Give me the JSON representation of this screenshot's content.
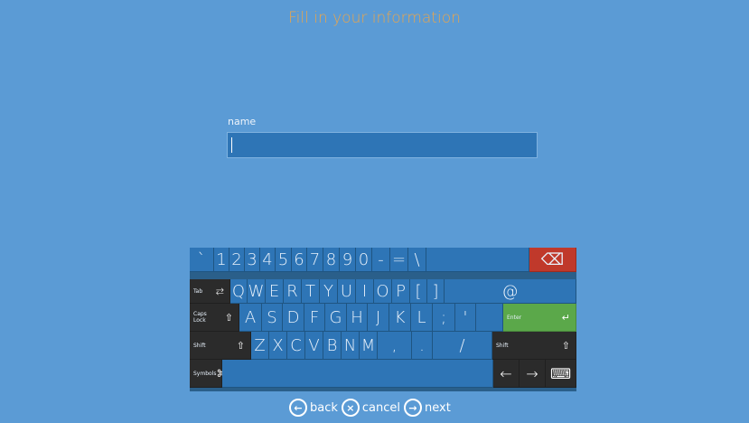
{
  "title": "Fill in your information",
  "field": {
    "label": "name",
    "value": ""
  },
  "keyboard": {
    "row1": [
      "`",
      "1",
      "2",
      "3",
      "4",
      "5",
      "6",
      "7",
      "8",
      "9",
      "0",
      "-",
      "=",
      "\\"
    ],
    "row2": [
      "Q",
      "W",
      "E",
      "R",
      "T",
      "Y",
      "U",
      "I",
      "O",
      "P",
      "[",
      "]",
      "@"
    ],
    "row3": [
      "A",
      "S",
      "D",
      "F",
      "G",
      "H",
      "J",
      "K",
      "L",
      ";",
      "'"
    ],
    "row4": [
      "Z",
      "X",
      "C",
      "V",
      "B",
      "N",
      "M",
      ",",
      ".",
      "/"
    ],
    "tab_label": "Tab",
    "caps_label_1": "Caps",
    "caps_label_2": "Lock",
    "enter_label": "Enter",
    "shift_label": "Shift",
    "symbols_label": "Symbols",
    "backspace_icon": "⌫",
    "tab_icon": "⇄",
    "caps_icon": "⇧",
    "enter_icon": "↵",
    "shift_icon": "⇧",
    "symbols_icon": "⌘",
    "left_arrow": "←",
    "right_arrow": "→",
    "keyboard_icon": "⌨"
  },
  "nav": {
    "back": "back",
    "cancel": "cancel",
    "next": "next",
    "back_icon": "←",
    "cancel_icon": "×",
    "next_icon": "→"
  }
}
